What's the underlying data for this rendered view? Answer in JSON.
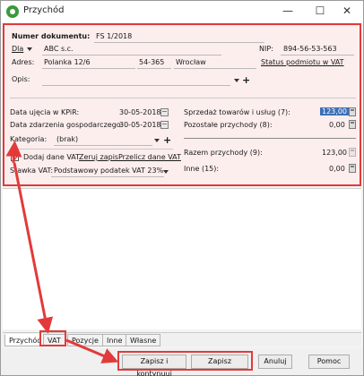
{
  "window": {
    "title": "Przychód",
    "minimize": "—",
    "maximize": "☐",
    "close": "✕"
  },
  "header": {
    "doc_number_label": "Numer dokumentu:",
    "doc_number": "FS 1/2018",
    "for_label": "Dla",
    "for_value": "ABC s.c.",
    "nip_label": "NIP:",
    "nip_value": "894-56-53-563",
    "address_label": "Adres:",
    "street": "Polanka 12/6",
    "postal_code": "54-365",
    "city": "Wrocław",
    "vat_status_link": "Status podmiotu w VAT",
    "description_label": "Opis:"
  },
  "dates": {
    "kpir_label": "Data ujęcia w KPiR:",
    "kpir_value": "30-05-2018",
    "event_label": "Data zdarzenia gospodarczego:",
    "event_value": "30-05-2018",
    "category_label": "Kategoria:",
    "category_value": "(brak)"
  },
  "vat": {
    "add_vat_label": "Dodaj dane VAT",
    "reset_link": "Zeruj zapis",
    "recalc_link": "Przelicz dane VAT",
    "rate_label": "Stawka VAT:",
    "rate_value": "Podstawowy podatek VAT 23%"
  },
  "amounts": {
    "sales_label": "Sprzedaż towarów i usług (7):",
    "sales_value": "123,00",
    "other_label": "Pozostałe przychody (8):",
    "other_value": "0,00",
    "total_label": "Razem przychody (9):",
    "total_value": "123,00",
    "misc_label": "Inne (15):",
    "misc_value": "0,00"
  },
  "tabs": [
    {
      "label": "Przychód"
    },
    {
      "label": "VAT"
    },
    {
      "label": "Pozycje"
    },
    {
      "label": "Inne"
    },
    {
      "label": "Własne"
    }
  ],
  "buttons": {
    "save_continue": "Zapisz i kontynuuj",
    "save": "Zapisz",
    "cancel": "Anuluj",
    "help": "Pomoc"
  },
  "colors": {
    "highlight": "#e23a3a",
    "selection": "#3d6fb6"
  }
}
